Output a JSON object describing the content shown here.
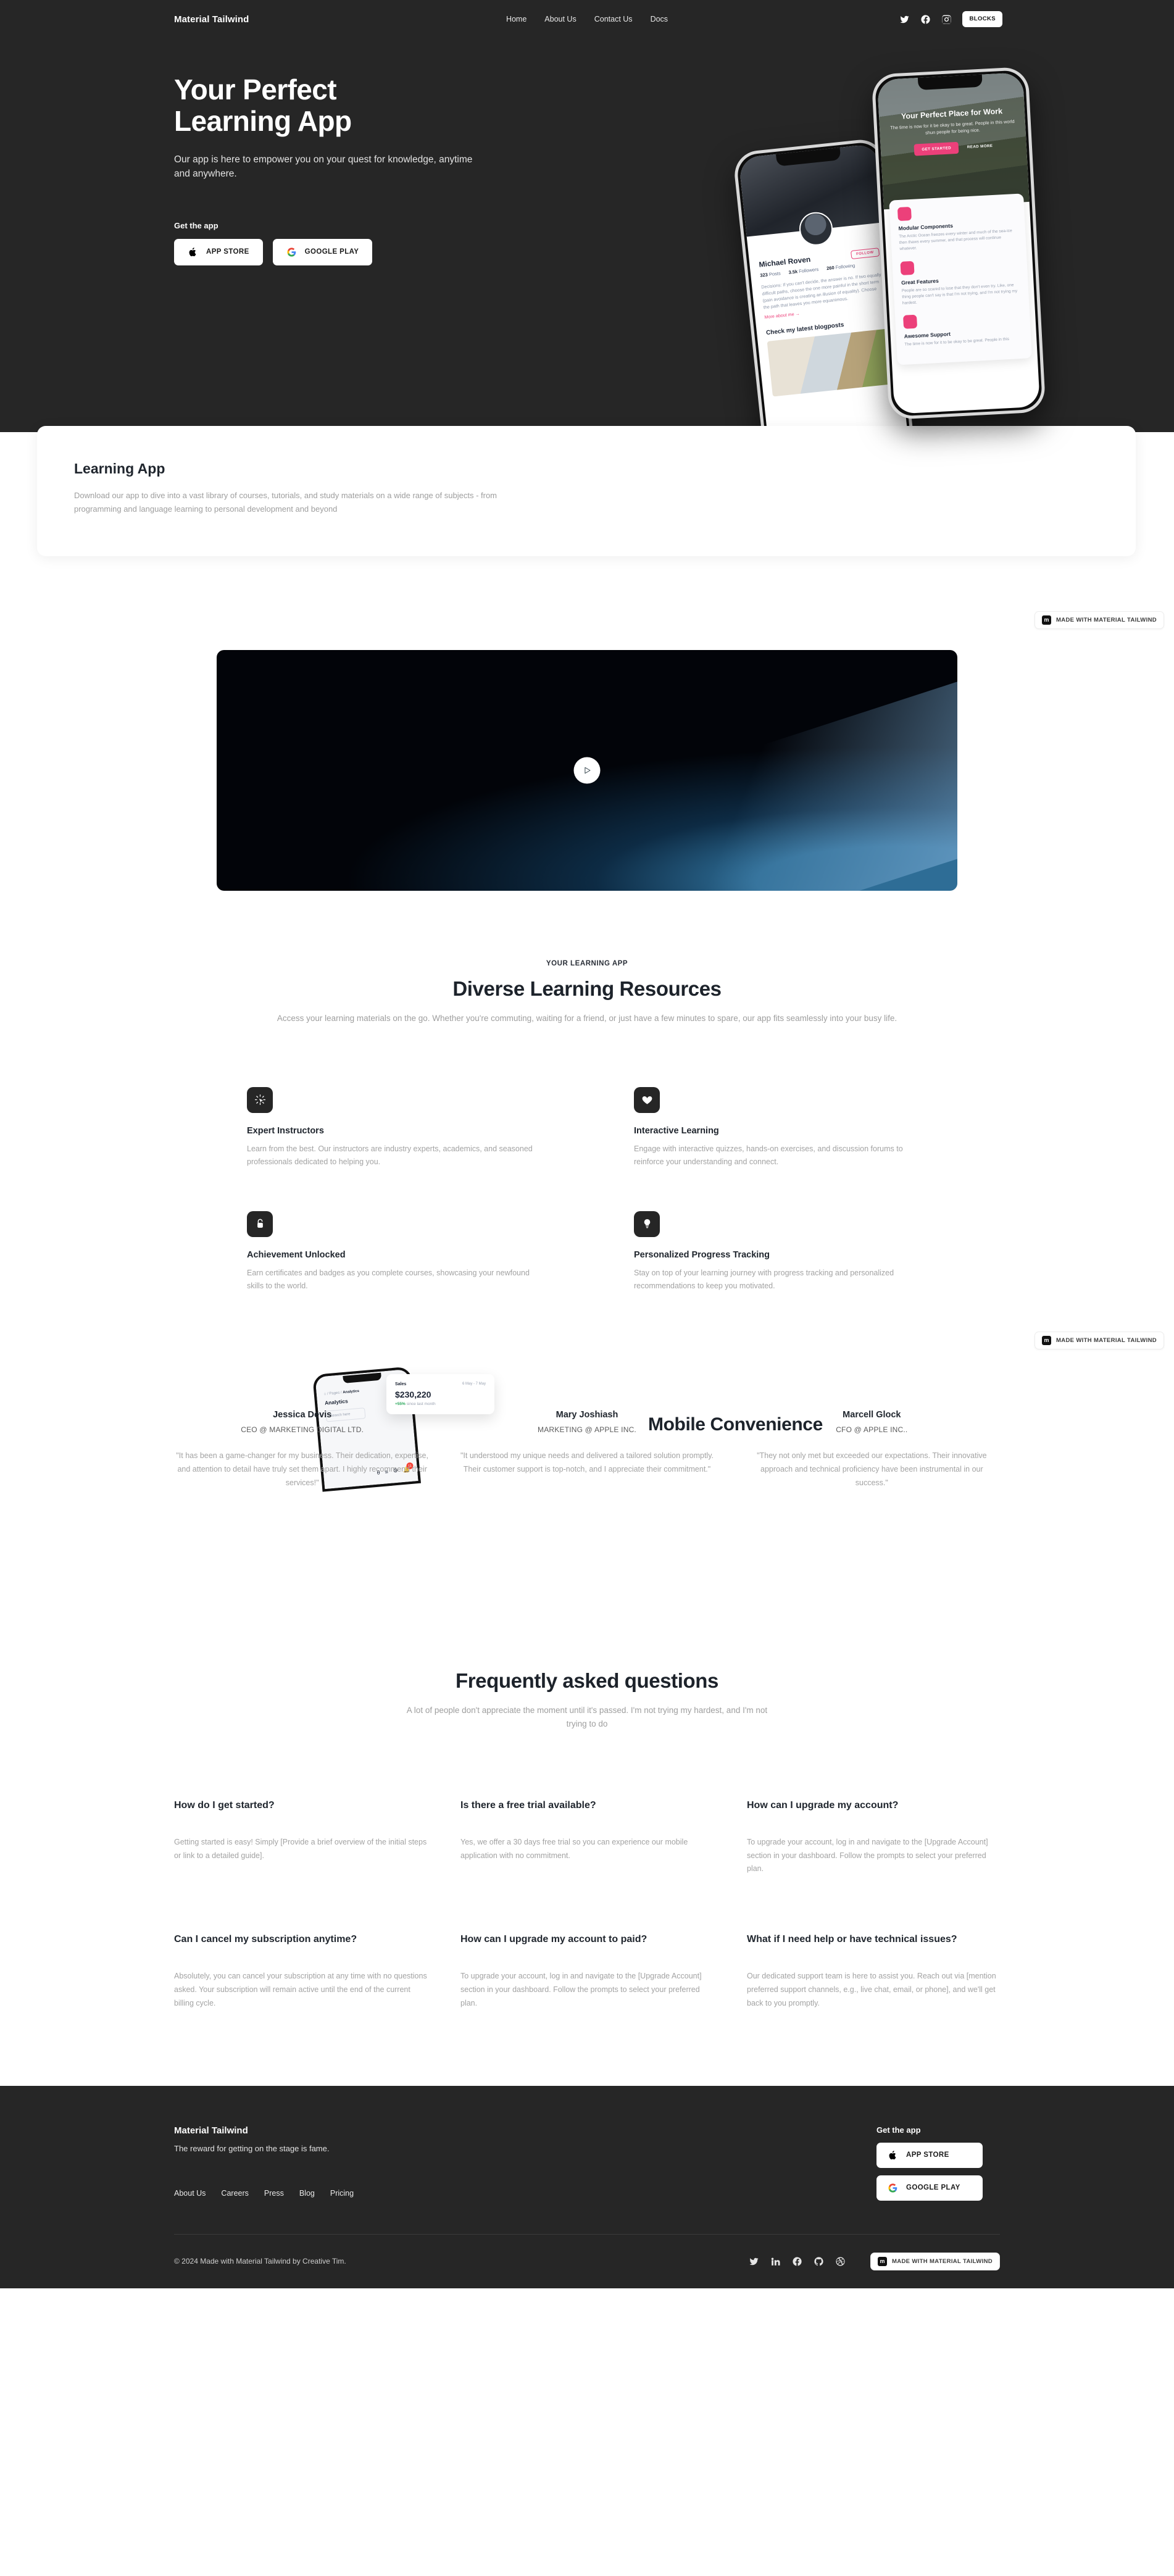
{
  "nav": {
    "brand": "Material Tailwind",
    "links": [
      "Home",
      "About Us",
      "Contact Us",
      "Docs"
    ],
    "social": [
      "twitter-icon",
      "facebook-icon",
      "instagram-icon"
    ],
    "blocks_label": "BLOCKS"
  },
  "hero": {
    "title_line1": "Your Perfect",
    "title_line2": "Learning App",
    "subtitle": "Our app is here to empower you on your quest for knowledge, anytime and anywhere.",
    "get_the_app": "Get the app",
    "app_store": "APP STORE",
    "google_play": "GOOGLE PLAY",
    "phone_back": {
      "name": "Michael Roven",
      "follow": "FOLLOW",
      "posts_count": "323",
      "posts_label": "Posts",
      "followers_count": "3.5k",
      "followers_label": "Followers",
      "following_count": "260",
      "following_label": "Following",
      "bio": "Decisions: If you can't decide, the answer is no. If two equally difficult paths, choose the one more painful in the short term (pain avoidance is creating an illusion of equality). Choose the path that leaves you more equanimous.",
      "more_link": "More about me →",
      "blog_heading": "Check my latest blogposts"
    },
    "phone_front": {
      "title": "Your Perfect Place for Work",
      "subtitle": "The time is now for it be okay to be great. People in this world shun people for being nice.",
      "cta": "GET STARTED",
      "read_more": "READ MORE",
      "cards": [
        {
          "title": "Modular Components",
          "text": "The Arctic Ocean freezes every winter and much of the sea-ice then thaws every summer, and that process will continue whatever."
        },
        {
          "title": "Great Features",
          "text": "People are so scared to lose that they don't even try. Like, one thing people can't say is that I'm not trying, and I'm not trying my hardest."
        },
        {
          "title": "Awesome Support",
          "text": "The time is now for it to be okay to be great. People in this"
        }
      ]
    }
  },
  "learning_card": {
    "title": "Learning App",
    "text": "Download our app to dive into a vast library of courses, tutorials, and study materials on a wide range of subjects - from programming and language learning to personal development and beyond"
  },
  "made_with_badge": {
    "mark": "m",
    "label": "MADE WITH MATERIAL TAILWIND"
  },
  "video": {
    "play_label": "play-button"
  },
  "features": {
    "eyebrow": "YOUR LEARNING APP",
    "heading": "Diverse Learning Resources",
    "description": "Access your learning materials on the go. Whether you're commuting, waiting for a friend, or just have a few minutes to spare, our app fits seamlessly into your busy life.",
    "items": [
      {
        "icon": "cursor-click-icon",
        "title": "Expert Instructors",
        "text": "Learn from the best. Our instructors are industry experts, academics, and seasoned professionals dedicated to helping you."
      },
      {
        "icon": "heart-icon",
        "title": "Interactive Learning",
        "text": "Engage with interactive quizzes, hands-on exercises, and discussion forums to reinforce your understanding and connect."
      },
      {
        "icon": "lock-icon",
        "title": "Achievement Unlocked",
        "text": "Earn certificates and badges as you complete courses, showcasing your newfound skills to the world."
      },
      {
        "icon": "lightbulb-icon",
        "title": "Personalized Progress Tracking",
        "text": "Stay on top of your learning journey with progress tracking and personalized recommendations to keep you motivated."
      }
    ]
  },
  "mobile_convenience": {
    "heading": "Mobile Convenience",
    "dashboard": {
      "breadcrumb_home": "⌂",
      "breadcrumb_pages": "Pages",
      "breadcrumb_current": "Analytics",
      "title": "Analytics",
      "search_placeholder": "Search here",
      "notification_count": "11"
    },
    "sales_card": {
      "label": "Sales",
      "date_range": "6 May - 7 May",
      "value": "$230,220",
      "delta": "+55%",
      "delta_text": "since last month"
    }
  },
  "testimonials": [
    {
      "name": "Jessica Devis",
      "role": "CEO @ MARKETING DIGITAL LTD.",
      "quote": "\"It has been a game-changer for my business. Their dedication, expertise, and attention to detail have truly set them apart. I highly recommend their services!\""
    },
    {
      "name": "Mary Joshiash",
      "role": "MARKETING @ APPLE INC.",
      "quote": "\"It understood my unique needs and delivered a tailored solution promptly. Their customer support is top-notch, and I appreciate their commitment.\""
    },
    {
      "name": "Marcell Glock",
      "role": "CFO @ APPLE INC..",
      "quote": "\"They not only met but exceeded our expectations. Their innovative approach and technical proficiency have been instrumental in our success.\""
    }
  ],
  "faq": {
    "heading": "Frequently asked questions",
    "description": "A lot of people don't appreciate the moment until it's passed. I'm not trying my hardest, and I'm not trying to do",
    "items": [
      {
        "question": "How do I get started?",
        "answer": "Getting started is easy! Simply [Provide a brief overview of the initial steps or link to a detailed guide]."
      },
      {
        "question": "Is there a free trial available?",
        "answer": "Yes, we offer a 30 days free trial so you can experience our mobile application with no commitment."
      },
      {
        "question": "How can I upgrade my account?",
        "answer": "To upgrade your account, log in and navigate to the [Upgrade Account] section in your dashboard. Follow the prompts to select your preferred plan."
      },
      {
        "question": "Can I cancel my subscription anytime?",
        "answer": "Absolutely, you can cancel your subscription at any time with no questions asked. Your subscription will remain active until the end of the current billing cycle."
      },
      {
        "question": "How can I upgrade my account to paid?",
        "answer": "To upgrade your account, log in and navigate to the [Upgrade Account] section in your dashboard. Follow the prompts to select your preferred plan."
      },
      {
        "question": "What if I need help or have technical issues?",
        "answer": "Our dedicated support team is here to assist you. Reach out via [mention preferred support channels, e.g., live chat, email, or phone], and we'll get back to you promptly."
      }
    ]
  },
  "footer": {
    "brand": "Material Tailwind",
    "tagline": "The reward for getting on the stage is fame.",
    "links": [
      "About Us",
      "Careers",
      "Press",
      "Blog",
      "Pricing"
    ],
    "get_the_app": "Get the app",
    "app_store": "APP STORE",
    "google_play": "GOOGLE PLAY",
    "copyright": "© 2024 Made with Material Tailwind by Creative Tim.",
    "social": [
      "twitter-icon",
      "linkedin-icon",
      "facebook-icon",
      "github-icon",
      "dribbble-icon"
    ]
  },
  "colors": {
    "dark": "#262626",
    "accent_pink": "#ec407a",
    "muted_text": "#9e9e9e",
    "green": "#23a455"
  }
}
